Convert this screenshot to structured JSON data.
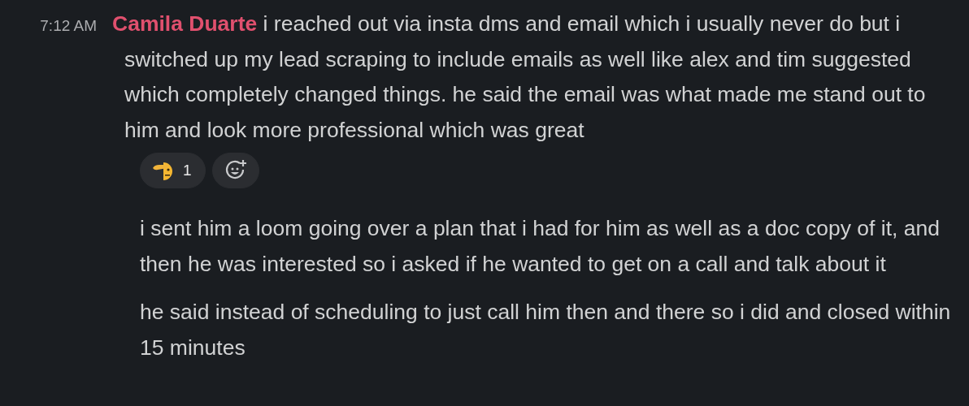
{
  "message": {
    "time": "7:12 AM",
    "author": "Camila Duarte",
    "paragraphs": [
      "i reached out via insta dms and email which i usually never do but i switched up my lead scraping to include emails as well like alex and tim suggested which completely changed things. he said the email was what made me stand out to him and look more professional which was great",
      "i sent him a loom going over a plan that i had for him as well as a doc copy of it, and then he was interested so i asked if he wanted to get on a call and talk about it",
      "he said instead of scheduling to just call him then and there so i did and closed within 15 minutes"
    ],
    "reactions": [
      {
        "count": "1",
        "selected": false
      }
    ]
  }
}
